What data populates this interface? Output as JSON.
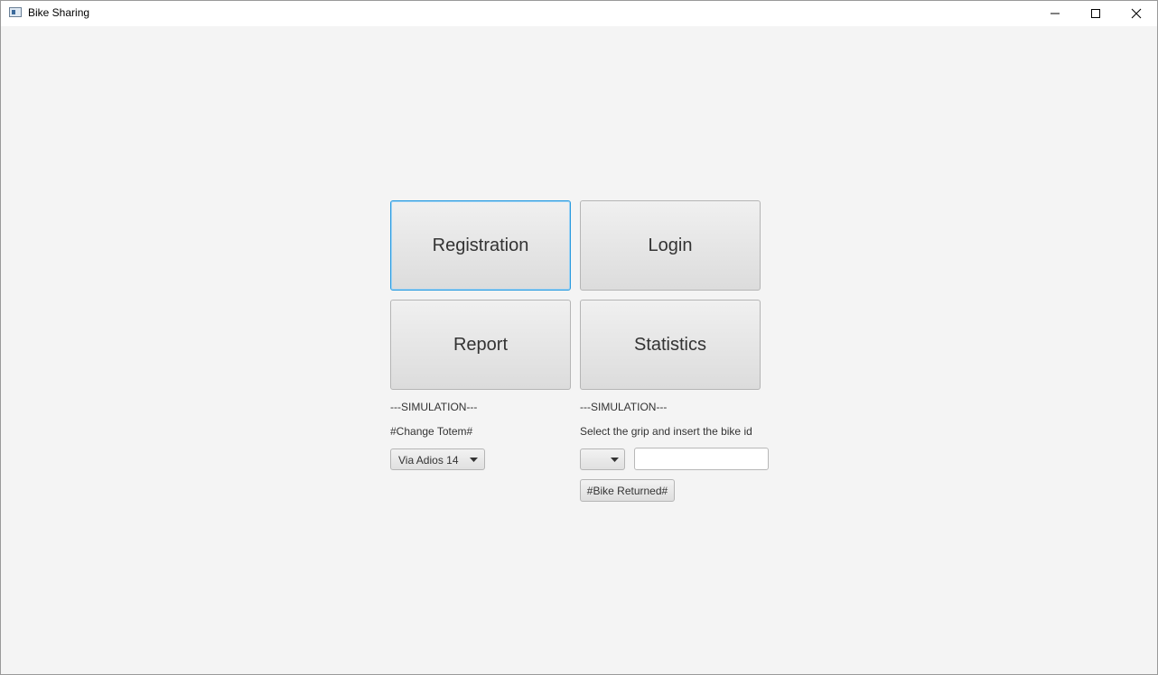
{
  "window": {
    "title": "Bike Sharing"
  },
  "main": {
    "registration_label": "Registration",
    "login_label": "Login",
    "report_label": "Report",
    "statistics_label": "Statistics"
  },
  "left_sim": {
    "header": "---SIMULATION---",
    "caption": "#Change Totem#",
    "totem_selected": "Via Adios 14"
  },
  "right_sim": {
    "header": "---SIMULATION---",
    "caption": "Select the grip and insert the bike id",
    "grip_selected": "",
    "bike_id_value": "",
    "bike_returned_label": "#Bike Returned#"
  },
  "colors": {
    "focus_accent": "#2b9ce0",
    "background": "#f4f4f4"
  }
}
